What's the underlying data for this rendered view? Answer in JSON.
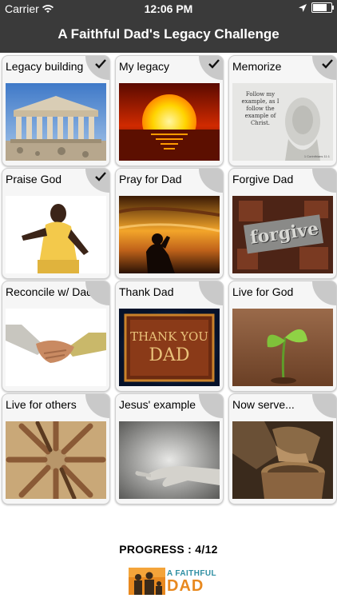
{
  "status_bar": {
    "carrier": "Carrier",
    "time": "12:06 PM",
    "battery_level": 0.85
  },
  "nav": {
    "title": "A Faithful Dad's Legacy Challenge"
  },
  "tiles": [
    {
      "label": "Legacy building",
      "checked": true,
      "image": "parthenon-image"
    },
    {
      "label": "My legacy",
      "checked": true,
      "image": "sunset-image"
    },
    {
      "label": "Memorize",
      "checked": true,
      "image": "jesus-verse-image"
    },
    {
      "label": "Praise God",
      "checked": true,
      "image": "praising-man-image"
    },
    {
      "label": "Pray for Dad",
      "checked": false,
      "image": "praying-silhouette-image"
    },
    {
      "label": "Forgive Dad",
      "checked": false,
      "image": "forgive-type-image"
    },
    {
      "label": "Reconcile w/ Dad",
      "checked": false,
      "image": "handshake-image"
    },
    {
      "label": "Thank Dad",
      "checked": false,
      "image": "thank-you-dad-image"
    },
    {
      "label": "Live for God",
      "checked": false,
      "image": "sprout-image"
    },
    {
      "label": "Live for others",
      "checked": false,
      "image": "circle-of-hands-image"
    },
    {
      "label": "Jesus' example",
      "checked": false,
      "image": "reaching-hand-image"
    },
    {
      "label": "Now serve...",
      "checked": false,
      "image": "washing-feet-image"
    }
  ],
  "image_text": {
    "verse": "Follow my example, as I follow the example of Christ.",
    "verse_ref": "1 Corinthians 11:1",
    "forgive_word": "forgive",
    "thank_you": "THANK YOU",
    "dad": "DAD"
  },
  "progress": {
    "label": "PROGRESS : 4/12",
    "completed": 4,
    "total": 12
  },
  "logo": {
    "line1": "A FAITHFUL",
    "line2": "DAD"
  },
  "colors": {
    "bar": "#3a3a3a",
    "check_corner": "#c9c9c9",
    "logo_orange": "#e8891f",
    "logo_teal": "#2f8fa3"
  }
}
